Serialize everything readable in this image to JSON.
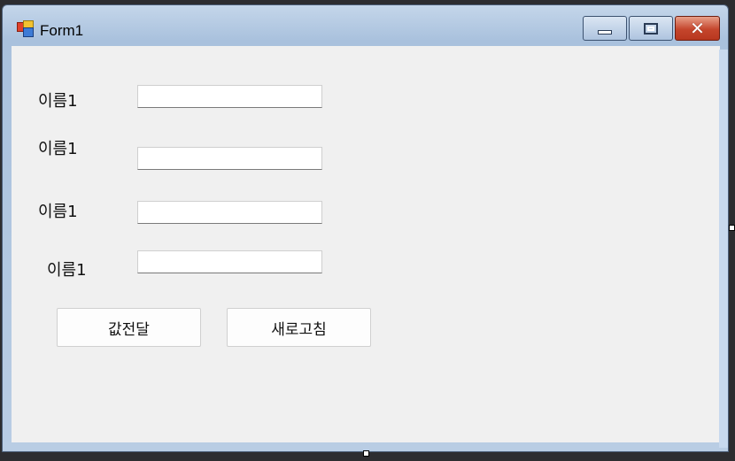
{
  "window": {
    "title": "Form1",
    "icon": "form-app-icon",
    "controls": {
      "minimize": "minimize-icon",
      "maximize": "maximize-icon",
      "close": "close-icon"
    }
  },
  "form": {
    "fields": [
      {
        "label": "이름1",
        "value": ""
      },
      {
        "label": "이름1",
        "value": ""
      },
      {
        "label": "이름1",
        "value": ""
      },
      {
        "label": "이름1",
        "value": ""
      }
    ],
    "buttons": {
      "send": "값전달",
      "refresh": "새로고침"
    }
  },
  "colors": {
    "client_bg": "#f0f0f0",
    "close_button": "#c4452c",
    "frame": "#a9c1dd"
  }
}
